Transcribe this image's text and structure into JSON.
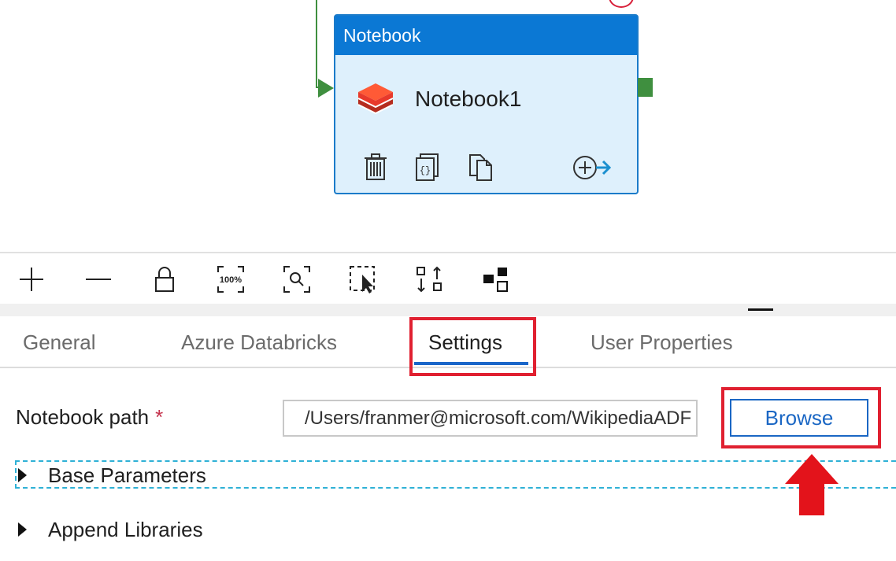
{
  "canvas": {
    "activity": {
      "type_label": "Notebook",
      "name": "Notebook1",
      "actions": [
        "delete-icon",
        "code-icon",
        "copy-icon",
        "add-output-icon"
      ]
    }
  },
  "toolbar": {
    "tools": [
      "zoom-in-icon",
      "zoom-out-icon",
      "lock-icon",
      "zoom-100-icon",
      "zoom-to-fit-icon",
      "select-region-icon",
      "auto-align-icon",
      "minimap-icon"
    ],
    "zoom_100_text": "100%"
  },
  "tabs": {
    "items": [
      {
        "label": "General"
      },
      {
        "label": "Azure Databricks"
      },
      {
        "label": "Settings"
      },
      {
        "label": "User Properties"
      }
    ],
    "active": "Settings"
  },
  "settings": {
    "notebook_path_label": "Notebook path",
    "required_marker": "*",
    "notebook_path_value": "/Users/franmer@microsoft.com/WikipediaADF",
    "browse_label": "Browse",
    "sections": [
      {
        "label": "Base Parameters"
      },
      {
        "label": "Append Libraries"
      }
    ]
  },
  "colors": {
    "accent_blue": "#0b78d4",
    "node_fill": "#def0fc",
    "success_green": "#3f8f3f",
    "callout_red": "#e02030",
    "databricks_red": "#e8392b"
  }
}
